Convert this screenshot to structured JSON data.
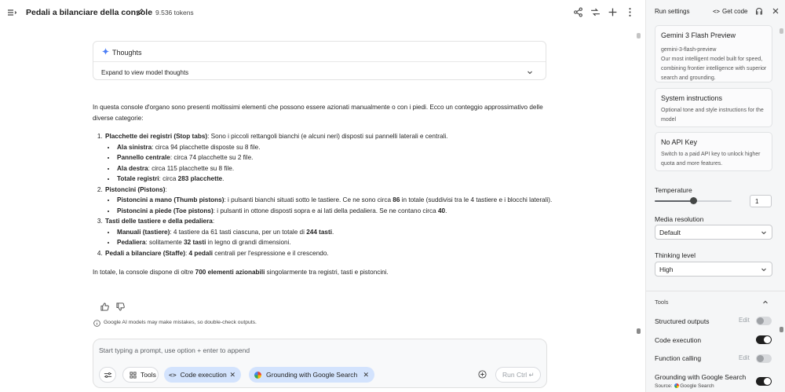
{
  "header": {
    "title": "Pedali a bilanciare della console",
    "tokens": "9.536 tokens"
  },
  "thoughts": {
    "label": "Thoughts",
    "expand_text": "Expand to view model thoughts"
  },
  "response": {
    "intro": "In questa console d'organo sono presenti moltissimi elementi che possono essere azionati manualmente o con i piedi. Ecco un conteggio approssimativo delle diverse categorie:",
    "s1_title": "Placchette dei registri (Stop tabs)",
    "s1_text": ": Sono i piccoli rettangoli bianchi (e alcuni neri) disposti sui pannelli laterali e centrali.",
    "s1_b1_label": "Ala sinistra",
    "s1_b1_text": ": circa 94 placchette disposte su 8 file.",
    "s1_b2_label": "Pannello centrale",
    "s1_b2_text": ": circa 74 placchette su 2 file.",
    "s1_b3_label": "Ala destra",
    "s1_b3_text": ": circa 115 placchette su 8 file.",
    "s1_b4_label": "Totale registri",
    "s1_b4_mid": ": circa ",
    "s1_b4_value": "283 placchette",
    "s1_b4_end": ".",
    "s2_title": "Pistoncini (Pistons)",
    "s2_colon": ":",
    "s2_b1_label": "Pistoncini a mano (Thumb pistons)",
    "s2_b1_text": ": i pulsanti bianchi situati sotto le tastiere. Ce ne sono circa ",
    "s2_b1_value": "86",
    "s2_b1_end": " in totale (suddivisi tra le 4 tastiere e i blocchi laterali).",
    "s2_b2_label": "Pistoncini a piede (Toe pistons)",
    "s2_b2_text": ": i pulsanti in ottone disposti sopra e ai lati della pedaliera. Se ne contano circa ",
    "s2_b2_value": "40",
    "s2_b2_end": ".",
    "s3_title": "Tasti delle tastiere e della pedaliera",
    "s3_colon": ":",
    "s3_b1_label": "Manuali (tastiere)",
    "s3_b1_text": ": 4 tastiere da 61 tasti ciascuna, per un totale di ",
    "s3_b1_value": "244 tasti",
    "s3_b1_end": ".",
    "s3_b2_label": "Pedaliera",
    "s3_b2_text": ": solitamente ",
    "s3_b2_value": "32 tasti",
    "s3_b2_end": " in legno di grandi dimensioni.",
    "s4_title": "Pedali a bilanciare (Staffe)",
    "s4_mid": ": ",
    "s4_value": "4 pedali",
    "s4_end": " centrali per l'espressione e il crescendo.",
    "outro_start": "In totale, la console dispone di oltre ",
    "outro_value": "700 elementi azionabili",
    "outro_end": " singolarmente tra registri, tasti e pistoncini."
  },
  "disclaimer": "Google AI models may make mistakes, so double-check outputs.",
  "prompt": {
    "placeholder": "Start typing a prompt, use option + enter to append",
    "tools_label": "Tools",
    "chip_code": "Code execution",
    "chip_grounding": "Grounding with Google Search",
    "run_label": "Run Ctrl ↵"
  },
  "panel": {
    "title": "Run settings",
    "get_code": "Get code",
    "model_name": "Gemini 3 Flash Preview",
    "model_id": "gemini-3-flash-preview",
    "model_desc": "Our most intelligent model built for speed, combining frontier intelligence with superior search and grounding.",
    "sys_title": "System instructions",
    "sys_desc": "Optional tone and style instructions for the model",
    "api_title": "No API Key",
    "api_desc": "Switch to a paid API key to unlock higher quota and more features.",
    "temperature_label": "Temperature",
    "temperature_value": "1",
    "temperature_fraction": 0.5,
    "media_label": "Media resolution",
    "media_value": "Default",
    "thinking_label": "Thinking level",
    "thinking_value": "High",
    "tools_heading": "Tools",
    "tool_structured": "Structured outputs",
    "tool_code": "Code execution",
    "tool_function": "Function calling",
    "tool_grounding": "Grounding with Google Search",
    "edit_label": "Edit",
    "source_label": "Source:",
    "source_value": "Google Search"
  }
}
